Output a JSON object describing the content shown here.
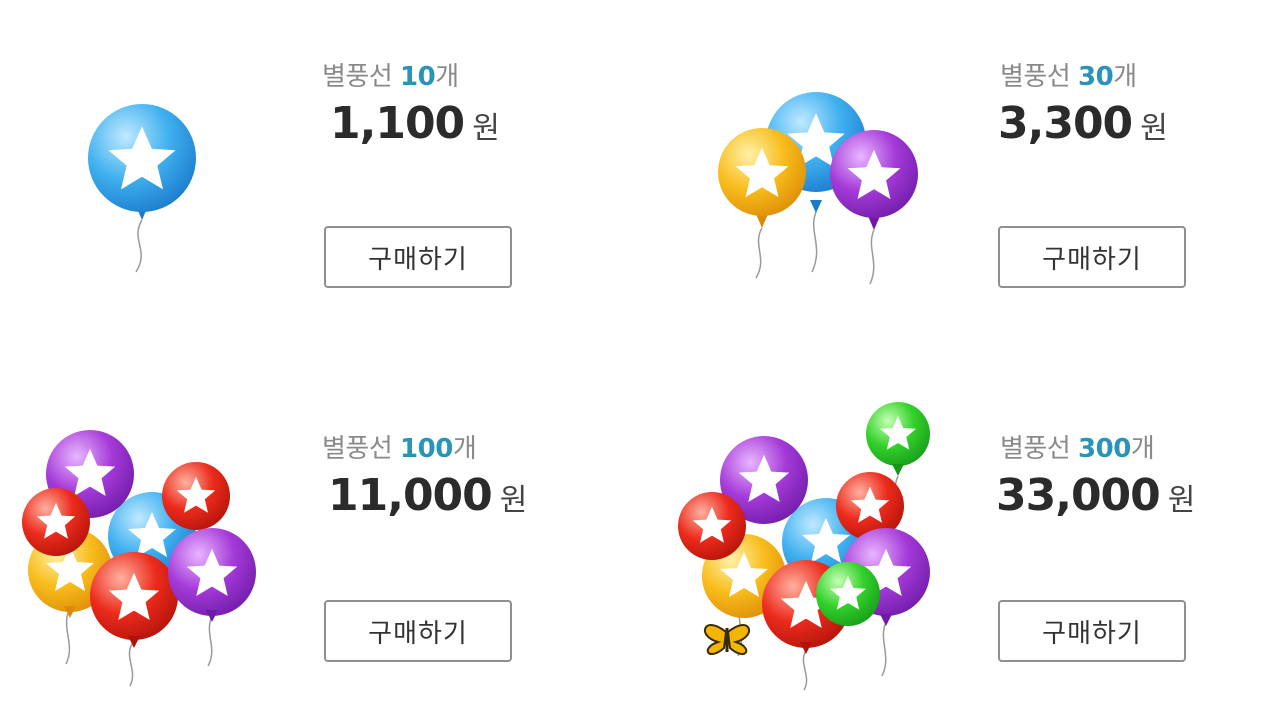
{
  "colors": {
    "accent_qty": "#2a93b8",
    "title_gray": "#8a8a8a",
    "price_dark": "#2b2b2b",
    "button_border": "#8f8f8f"
  },
  "products": [
    {
      "name": "별풍선",
      "quantity": "10",
      "suffix": "개",
      "price": "1,100",
      "currency": "원",
      "button_label": "구매하기",
      "icon": "balloon-icon"
    },
    {
      "name": "별풍선",
      "quantity": "30",
      "suffix": "개",
      "price": "3,300",
      "currency": "원",
      "button_label": "구매하기",
      "icon": "balloon-bunch-icon"
    },
    {
      "name": "별풍선",
      "quantity": "100",
      "suffix": "개",
      "price": "11,000",
      "currency": "원",
      "button_label": "구매하기",
      "icon": "balloon-bunch-icon"
    },
    {
      "name": "별풍선",
      "quantity": "300",
      "suffix": "개",
      "price": "33,000",
      "currency": "원",
      "button_label": "구매하기",
      "icon": "balloon-bunch-butterfly-icon"
    }
  ]
}
